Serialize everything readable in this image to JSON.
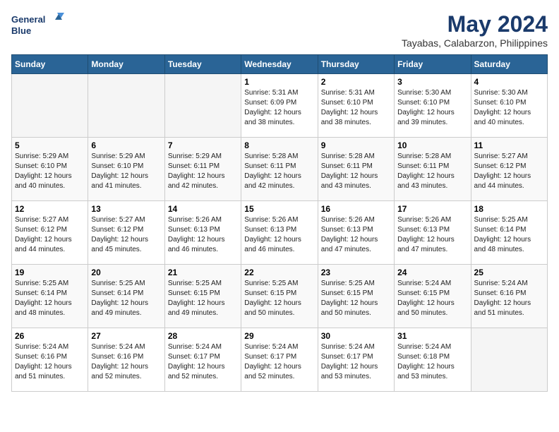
{
  "logo": {
    "line1": "General",
    "line2": "Blue"
  },
  "title": "May 2024",
  "location": "Tayabas, Calabarzon, Philippines",
  "weekdays": [
    "Sunday",
    "Monday",
    "Tuesday",
    "Wednesday",
    "Thursday",
    "Friday",
    "Saturday"
  ],
  "weeks": [
    [
      {
        "day": "",
        "sunrise": "",
        "sunset": "",
        "daylight": ""
      },
      {
        "day": "",
        "sunrise": "",
        "sunset": "",
        "daylight": ""
      },
      {
        "day": "",
        "sunrise": "",
        "sunset": "",
        "daylight": ""
      },
      {
        "day": "1",
        "sunrise": "Sunrise: 5:31 AM",
        "sunset": "Sunset: 6:09 PM",
        "daylight": "Daylight: 12 hours and 38 minutes."
      },
      {
        "day": "2",
        "sunrise": "Sunrise: 5:31 AM",
        "sunset": "Sunset: 6:10 PM",
        "daylight": "Daylight: 12 hours and 38 minutes."
      },
      {
        "day": "3",
        "sunrise": "Sunrise: 5:30 AM",
        "sunset": "Sunset: 6:10 PM",
        "daylight": "Daylight: 12 hours and 39 minutes."
      },
      {
        "day": "4",
        "sunrise": "Sunrise: 5:30 AM",
        "sunset": "Sunset: 6:10 PM",
        "daylight": "Daylight: 12 hours and 40 minutes."
      }
    ],
    [
      {
        "day": "5",
        "sunrise": "Sunrise: 5:29 AM",
        "sunset": "Sunset: 6:10 PM",
        "daylight": "Daylight: 12 hours and 40 minutes."
      },
      {
        "day": "6",
        "sunrise": "Sunrise: 5:29 AM",
        "sunset": "Sunset: 6:10 PM",
        "daylight": "Daylight: 12 hours and 41 minutes."
      },
      {
        "day": "7",
        "sunrise": "Sunrise: 5:29 AM",
        "sunset": "Sunset: 6:11 PM",
        "daylight": "Daylight: 12 hours and 42 minutes."
      },
      {
        "day": "8",
        "sunrise": "Sunrise: 5:28 AM",
        "sunset": "Sunset: 6:11 PM",
        "daylight": "Daylight: 12 hours and 42 minutes."
      },
      {
        "day": "9",
        "sunrise": "Sunrise: 5:28 AM",
        "sunset": "Sunset: 6:11 PM",
        "daylight": "Daylight: 12 hours and 43 minutes."
      },
      {
        "day": "10",
        "sunrise": "Sunrise: 5:28 AM",
        "sunset": "Sunset: 6:11 PM",
        "daylight": "Daylight: 12 hours and 43 minutes."
      },
      {
        "day": "11",
        "sunrise": "Sunrise: 5:27 AM",
        "sunset": "Sunset: 6:12 PM",
        "daylight": "Daylight: 12 hours and 44 minutes."
      }
    ],
    [
      {
        "day": "12",
        "sunrise": "Sunrise: 5:27 AM",
        "sunset": "Sunset: 6:12 PM",
        "daylight": "Daylight: 12 hours and 44 minutes."
      },
      {
        "day": "13",
        "sunrise": "Sunrise: 5:27 AM",
        "sunset": "Sunset: 6:12 PM",
        "daylight": "Daylight: 12 hours and 45 minutes."
      },
      {
        "day": "14",
        "sunrise": "Sunrise: 5:26 AM",
        "sunset": "Sunset: 6:13 PM",
        "daylight": "Daylight: 12 hours and 46 minutes."
      },
      {
        "day": "15",
        "sunrise": "Sunrise: 5:26 AM",
        "sunset": "Sunset: 6:13 PM",
        "daylight": "Daylight: 12 hours and 46 minutes."
      },
      {
        "day": "16",
        "sunrise": "Sunrise: 5:26 AM",
        "sunset": "Sunset: 6:13 PM",
        "daylight": "Daylight: 12 hours and 47 minutes."
      },
      {
        "day": "17",
        "sunrise": "Sunrise: 5:26 AM",
        "sunset": "Sunset: 6:13 PM",
        "daylight": "Daylight: 12 hours and 47 minutes."
      },
      {
        "day": "18",
        "sunrise": "Sunrise: 5:25 AM",
        "sunset": "Sunset: 6:14 PM",
        "daylight": "Daylight: 12 hours and 48 minutes."
      }
    ],
    [
      {
        "day": "19",
        "sunrise": "Sunrise: 5:25 AM",
        "sunset": "Sunset: 6:14 PM",
        "daylight": "Daylight: 12 hours and 48 minutes."
      },
      {
        "day": "20",
        "sunrise": "Sunrise: 5:25 AM",
        "sunset": "Sunset: 6:14 PM",
        "daylight": "Daylight: 12 hours and 49 minutes."
      },
      {
        "day": "21",
        "sunrise": "Sunrise: 5:25 AM",
        "sunset": "Sunset: 6:15 PM",
        "daylight": "Daylight: 12 hours and 49 minutes."
      },
      {
        "day": "22",
        "sunrise": "Sunrise: 5:25 AM",
        "sunset": "Sunset: 6:15 PM",
        "daylight": "Daylight: 12 hours and 50 minutes."
      },
      {
        "day": "23",
        "sunrise": "Sunrise: 5:25 AM",
        "sunset": "Sunset: 6:15 PM",
        "daylight": "Daylight: 12 hours and 50 minutes."
      },
      {
        "day": "24",
        "sunrise": "Sunrise: 5:24 AM",
        "sunset": "Sunset: 6:15 PM",
        "daylight": "Daylight: 12 hours and 50 minutes."
      },
      {
        "day": "25",
        "sunrise": "Sunrise: 5:24 AM",
        "sunset": "Sunset: 6:16 PM",
        "daylight": "Daylight: 12 hours and 51 minutes."
      }
    ],
    [
      {
        "day": "26",
        "sunrise": "Sunrise: 5:24 AM",
        "sunset": "Sunset: 6:16 PM",
        "daylight": "Daylight: 12 hours and 51 minutes."
      },
      {
        "day": "27",
        "sunrise": "Sunrise: 5:24 AM",
        "sunset": "Sunset: 6:16 PM",
        "daylight": "Daylight: 12 hours and 52 minutes."
      },
      {
        "day": "28",
        "sunrise": "Sunrise: 5:24 AM",
        "sunset": "Sunset: 6:17 PM",
        "daylight": "Daylight: 12 hours and 52 minutes."
      },
      {
        "day": "29",
        "sunrise": "Sunrise: 5:24 AM",
        "sunset": "Sunset: 6:17 PM",
        "daylight": "Daylight: 12 hours and 52 minutes."
      },
      {
        "day": "30",
        "sunrise": "Sunrise: 5:24 AM",
        "sunset": "Sunset: 6:17 PM",
        "daylight": "Daylight: 12 hours and 53 minutes."
      },
      {
        "day": "31",
        "sunrise": "Sunrise: 5:24 AM",
        "sunset": "Sunset: 6:18 PM",
        "daylight": "Daylight: 12 hours and 53 minutes."
      },
      {
        "day": "",
        "sunrise": "",
        "sunset": "",
        "daylight": ""
      }
    ]
  ]
}
